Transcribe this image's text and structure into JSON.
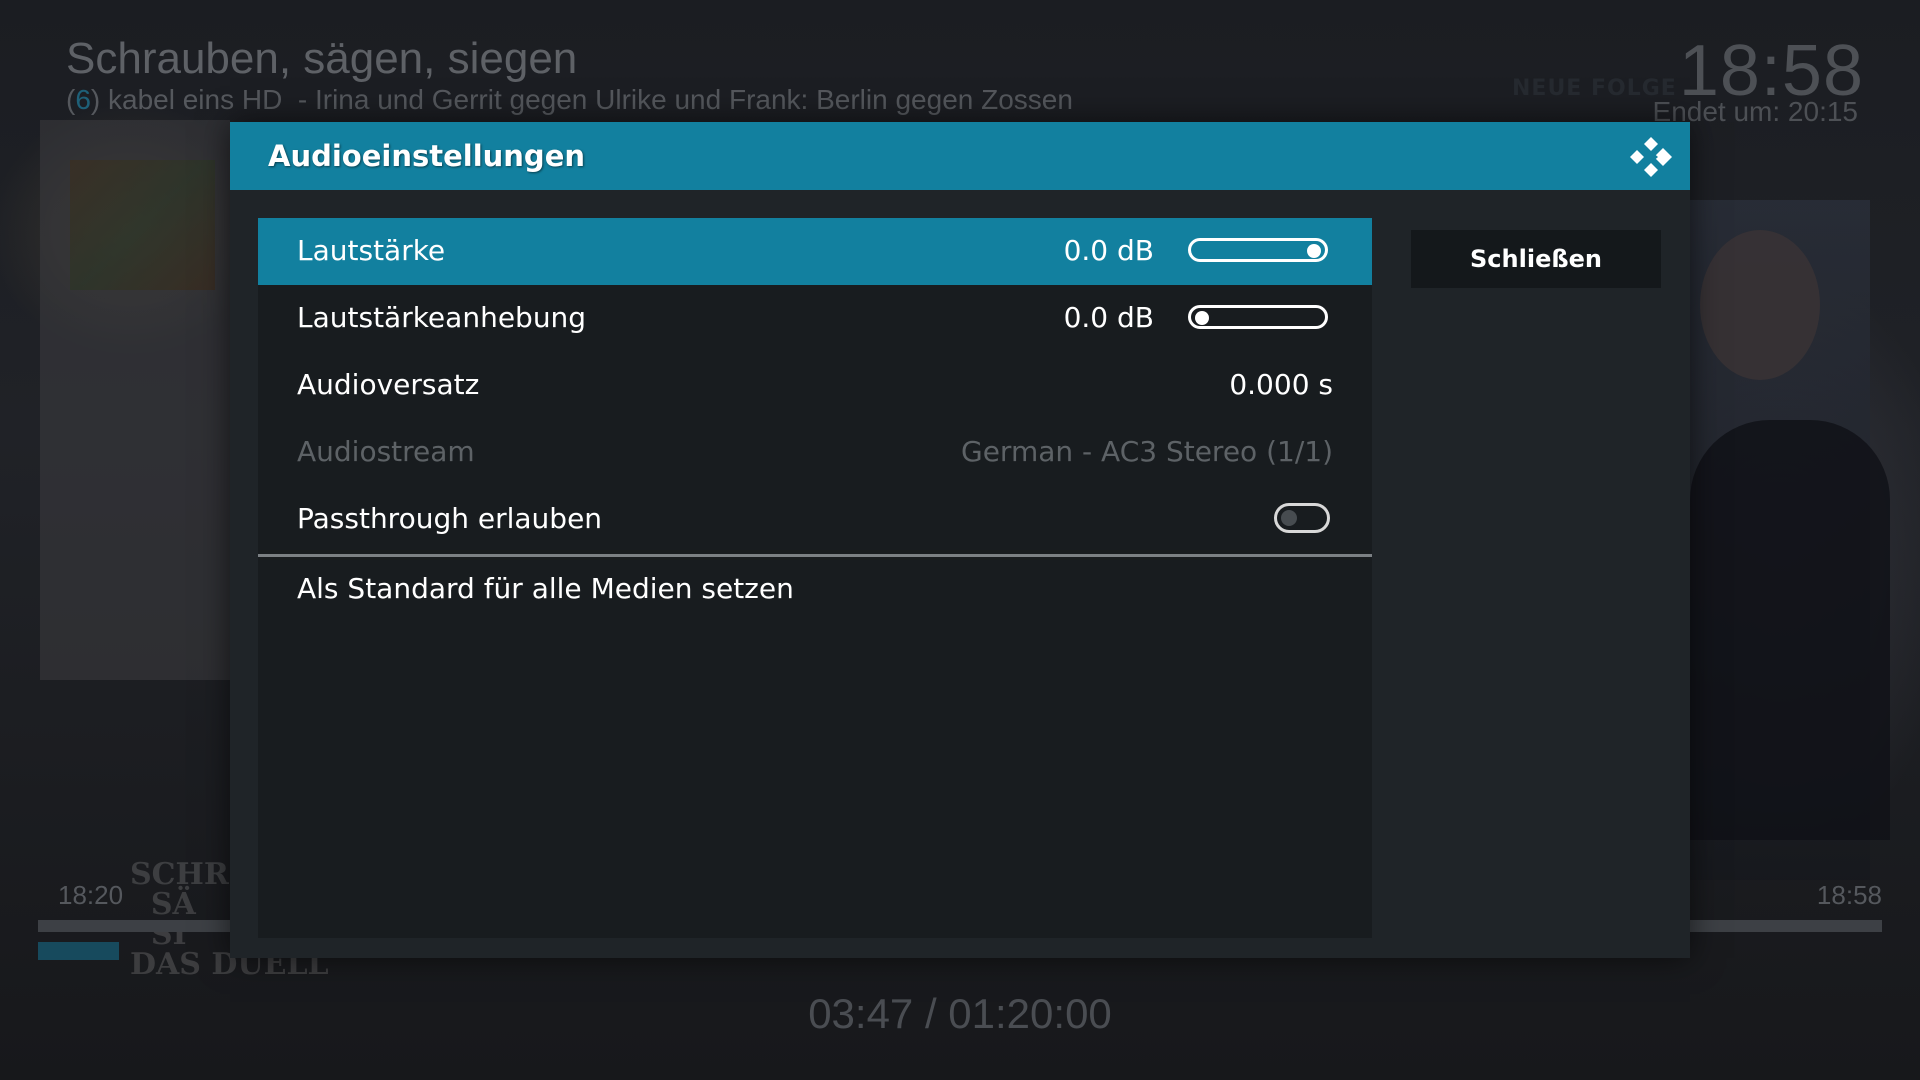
{
  "osd": {
    "show_title": "Schrauben, sägen, siegen",
    "channel_paren_open": "(",
    "channel_number": "6",
    "channel_name": ") kabel eins HD",
    "episode_title": "- Irina und Gerrit gegen Ulrike und Frank: Berlin gegen Zossen",
    "clock": "18:58",
    "new_episode_badge": "NEUE FOLGE",
    "end_time": "Endet um: 20:15",
    "start_time": "18:20",
    "current_time": "18:58",
    "playback_time": "03:47 / 01:20:00",
    "progress_fraction": 0.044,
    "colors": {
      "accent": "#12809f",
      "progress": "#174a5d"
    }
  },
  "dialog": {
    "title": "Audioeinstellungen",
    "logo_icon": "kodi-logo-icon",
    "close_label": "Schließen",
    "settings": [
      {
        "label": "Lautstärke",
        "value": "0.0 dB",
        "control": "slider",
        "level": 1.0,
        "focused": true,
        "enabled": true
      },
      {
        "label": "Lautstärkeanhebung",
        "value": "0.0 dB",
        "control": "slider",
        "level": 0.0,
        "focused": false,
        "enabled": true
      },
      {
        "label": "Audioversatz",
        "value": "0.000 s",
        "control": "value",
        "focused": false,
        "enabled": true
      },
      {
        "label": "Audiostream",
        "value": "German - AC3 Stereo (1/1)",
        "control": "value",
        "focused": false,
        "enabled": false
      },
      {
        "label": "Passthrough erlauben",
        "control": "toggle",
        "checked": false,
        "focused": false,
        "enabled": true
      }
    ],
    "set_default_label": "Als Standard für alle Medien setzen"
  }
}
